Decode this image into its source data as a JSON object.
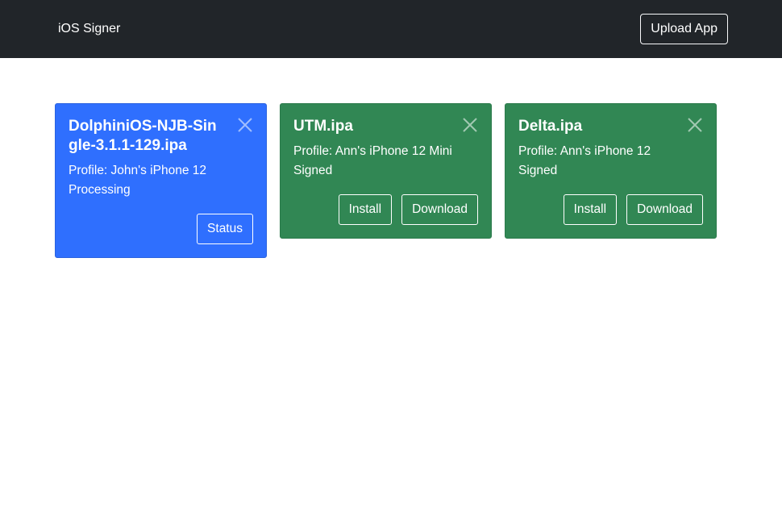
{
  "navbar": {
    "brand": "iOS Signer",
    "upload_label": "Upload App"
  },
  "colors": {
    "navbar_bg": "#212529",
    "processing_card": "#2f6ffe",
    "signed_card": "#318754"
  },
  "cards": [
    {
      "title": "DolphiniOS-NJB-Single-3.1.1-129.ipa",
      "profile": "Profile: John's iPhone 12",
      "status": "Processing",
      "buttons": [
        "Status"
      ],
      "close_icon": "close-icon"
    },
    {
      "title": "UTM.ipa",
      "profile": "Profile: Ann's iPhone 12 Mini",
      "status": "Signed",
      "buttons": [
        "Install",
        "Download"
      ],
      "close_icon": "close-icon"
    },
    {
      "title": "Delta.ipa",
      "profile": "Profile: Ann's iPhone 12",
      "status": "Signed",
      "buttons": [
        "Install",
        "Download"
      ],
      "close_icon": "close-icon"
    }
  ]
}
